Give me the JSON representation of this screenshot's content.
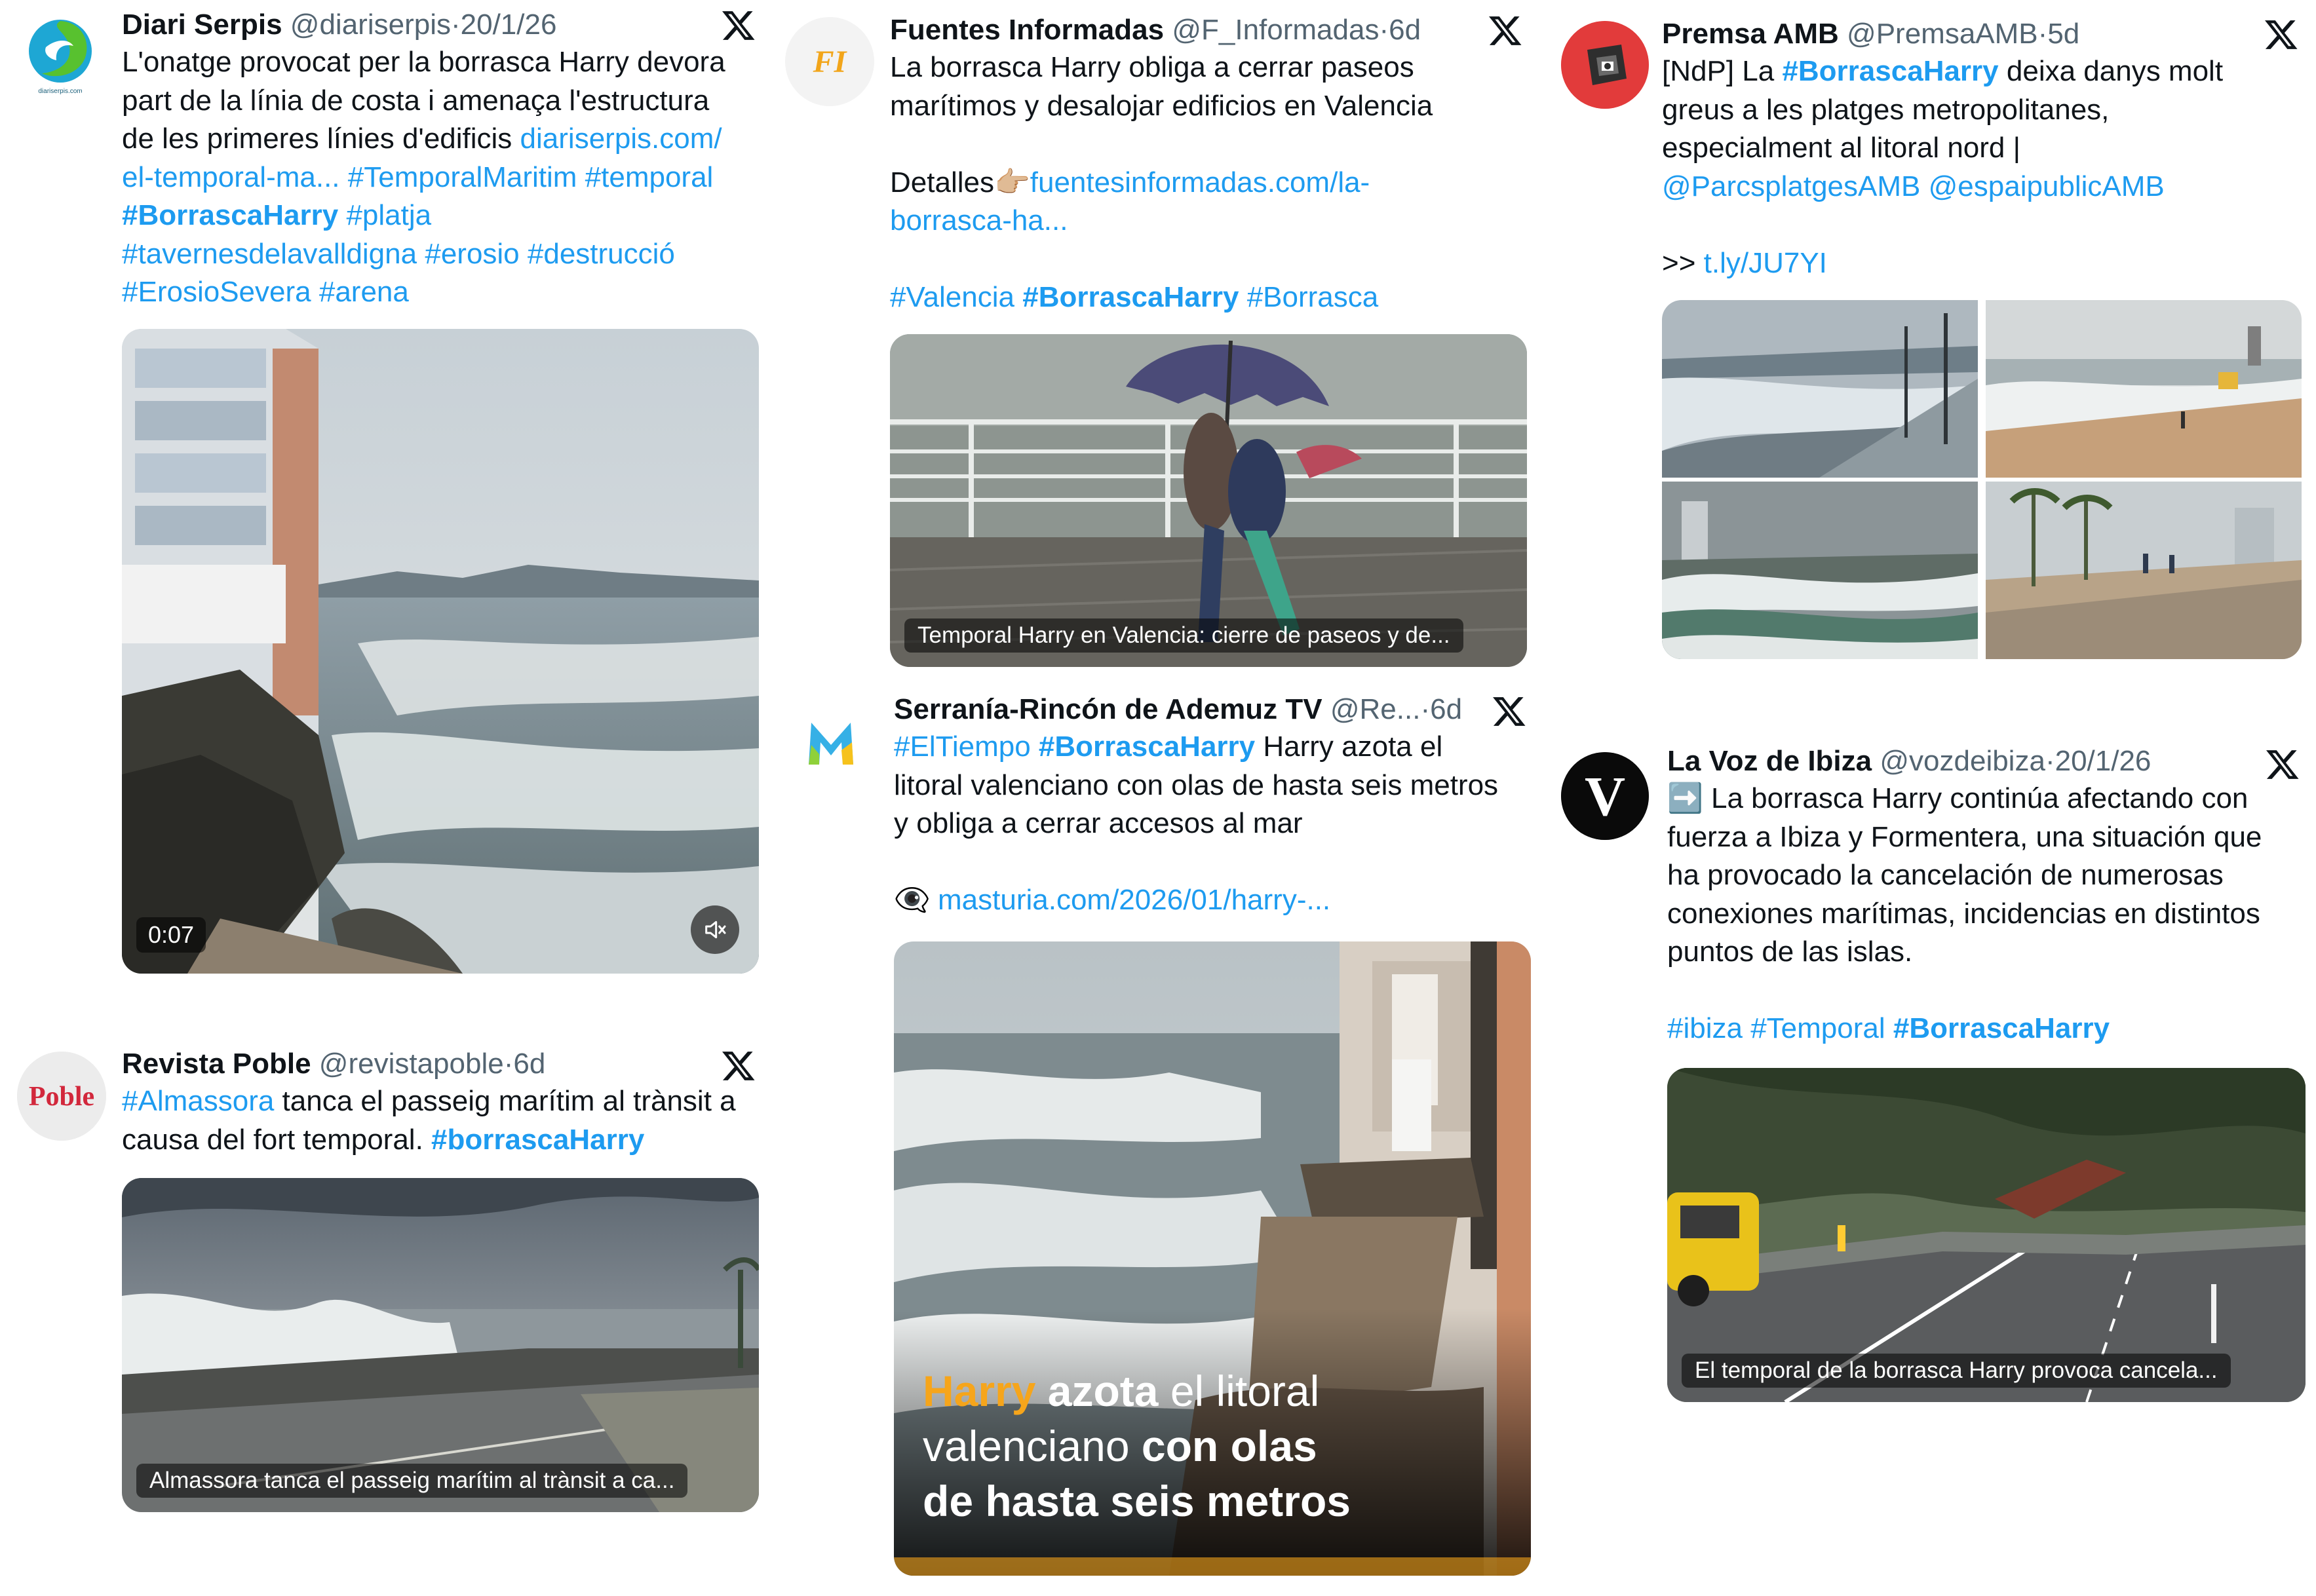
{
  "tweets": [
    {
      "name": "Diari Serpis",
      "handle": "@diariserpis",
      "sep": "·",
      "date": "20/1/26",
      "avatar_icon": "diari-serpis-logo",
      "avatar_label": "diariserpis.com",
      "lines": [
        [
          {
            "t": "L'onatge provocat per la borrasca Harry devora"
          }
        ],
        [
          {
            "t": "part de la línia de costa i amenaça l'estructura"
          }
        ],
        [
          {
            "t": "de les primeres línies d'edificis "
          },
          {
            "t": "diariserpis.com/",
            "k": "link"
          }
        ],
        [
          {
            "t": "el-temporal-ma...",
            "k": "link"
          },
          {
            "t": " "
          },
          {
            "t": "#TemporalMaritim",
            "k": "htag"
          },
          {
            "t": " "
          },
          {
            "t": "#temporal",
            "k": "htag"
          }
        ],
        [
          {
            "t": "#BorrascaHarry",
            "k": "htag b"
          },
          {
            "t": " "
          },
          {
            "t": "#platja",
            "k": "htag"
          }
        ],
        [
          {
            "t": "#tavernesdelavalldigna",
            "k": "htag"
          },
          {
            "t": " "
          },
          {
            "t": "#erosio",
            "k": "htag"
          },
          {
            "t": " "
          },
          {
            "t": "#destrucció",
            "k": "htag"
          }
        ],
        [
          {
            "t": "#ErosioSevera",
            "k": "htag"
          },
          {
            "t": " "
          },
          {
            "t": "#arena",
            "k": "htag"
          }
        ]
      ],
      "video_duration": "0:07"
    },
    {
      "name": "Revista Poble",
      "handle": "@revistapoble",
      "sep": "·",
      "date": "6d",
      "avatar_icon": "revista-poble-logo",
      "avatar_label": "Poble",
      "lines": [
        [
          {
            "t": "#Almassora",
            "k": "htag"
          },
          {
            "t": " tanca el passeig marítim al trànsit a"
          }
        ],
        [
          {
            "t": "causa del fort temporal. "
          },
          {
            "t": "#borrascaHarry",
            "k": "htag b"
          }
        ]
      ],
      "media_caption": "Almassora tanca el passeig marítim al trànsit a ca..."
    },
    {
      "name": "Fuentes Informadas",
      "handle": "@F_Informadas",
      "sep": "·",
      "date": "6d",
      "avatar_icon": "fuentes-informadas-logo",
      "avatar_label": "FI",
      "lines": [
        [
          {
            "t": "La borrasca Harry obliga a cerrar paseos"
          }
        ],
        [
          {
            "t": "marítimos y desalojar edificios en Valencia"
          }
        ],
        [
          {
            "t": ""
          }
        ],
        [
          {
            "t": "Detalles👉🏼"
          },
          {
            "t": "fuentesinformadas.com/la-",
            "k": "link"
          }
        ],
        [
          {
            "t": "borrasca-ha...",
            "k": "link"
          }
        ],
        [
          {
            "t": ""
          }
        ],
        [
          {
            "t": "#Valencia",
            "k": "htag"
          },
          {
            "t": " "
          },
          {
            "t": "#BorrascaHarry",
            "k": "htag b"
          },
          {
            "t": " "
          },
          {
            "t": "#Borrasca",
            "k": "htag"
          }
        ]
      ],
      "media_caption": "Temporal Harry en Valencia: cierre de paseos y de..."
    },
    {
      "name": "Serranía-Rincón de Ademuz TV",
      "handle": "@Re...",
      "sep": "·",
      "date": "6d",
      "avatar_icon": "serrania-m-logo",
      "lines": [
        [
          {
            "t": "#ElTiempo",
            "k": "htag"
          },
          {
            "t": " "
          },
          {
            "t": "#BorrascaHarry",
            "k": "htag b"
          },
          {
            "t": " Harry azota el"
          }
        ],
        [
          {
            "t": "litoral valenciano con olas de hasta seis metros"
          }
        ],
        [
          {
            "t": "y obliga a cerrar accesos al mar"
          }
        ],
        [
          {
            "t": ""
          }
        ],
        [
          {
            "t": "👁‍🗨 "
          },
          {
            "t": "masturia.com/2026/01/harry-...",
            "k": "link"
          }
        ]
      ],
      "overlay": {
        "w1": "Harry",
        "w2": " azota",
        "w3": " el litoral",
        "w4": "valenciano ",
        "w5": "con olas",
        "w6": "de hasta seis metros"
      }
    },
    {
      "name": "Premsa AMB",
      "handle": "@PremsaAMB",
      "sep": "·",
      "date": "5d",
      "avatar_icon": "premsa-amb-logo",
      "lines": [
        [
          {
            "t": "[NdP] La "
          },
          {
            "t": "#BorrascaHarry",
            "k": "htag b"
          },
          {
            "t": " deixa danys molt"
          }
        ],
        [
          {
            "t": "greus a les platges metropolitanes,"
          }
        ],
        [
          {
            "t": "especialment al litoral nord |"
          }
        ],
        [
          {
            "t": "@ParcsplatgesAMB",
            "k": "link"
          },
          {
            "t": " "
          },
          {
            "t": "@espaipublicAMB",
            "k": "link"
          }
        ],
        [
          {
            "t": ""
          }
        ],
        [
          {
            "t": ">> "
          },
          {
            "t": "t.ly/JU7YI",
            "k": "link"
          }
        ]
      ]
    },
    {
      "name": "La Voz de Ibiza",
      "handle": "@vozdeibiza",
      "sep": "·",
      "date": "20/1/26",
      "avatar_icon": "la-voz-v-logo",
      "avatar_label": "V",
      "lines": [
        [
          {
            "t": "➡️ La borrasca Harry continúa afectando con"
          }
        ],
        [
          {
            "t": "fuerza a Ibiza y Formentera, una situación que"
          }
        ],
        [
          {
            "t": "ha provocado la cancelación de numerosas"
          }
        ],
        [
          {
            "t": "conexiones marítimas, incidencias en distintos"
          }
        ],
        [
          {
            "t": "puntos de las islas."
          }
        ],
        [
          {
            "t": ""
          }
        ],
        [
          {
            "t": "#ibiza",
            "k": "htag"
          },
          {
            "t": " "
          },
          {
            "t": "#Temporal",
            "k": "htag"
          },
          {
            "t": " "
          },
          {
            "t": "#BorrascaHarry",
            "k": "htag b"
          }
        ]
      ],
      "media_caption": "El temporal de la borrasca Harry provoca cancela..."
    }
  ],
  "colors": {
    "link": "#1d9bf0",
    "text": "#0f1419",
    "meta": "#536471",
    "overlay_highlight": "#f6a51b"
  },
  "icons": {
    "platform": "x-logo-icon",
    "mute": "speaker-muted-icon"
  }
}
